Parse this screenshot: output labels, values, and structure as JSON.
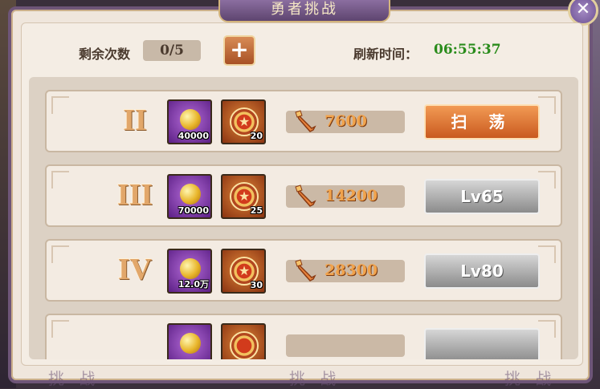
{
  "header": {
    "title": "勇者挑战",
    "close_glyph": "✕"
  },
  "stats": {
    "remaining_label": "剩余次数",
    "remaining_value": "0/5",
    "add_glyph": "+",
    "refresh_label": "刷新时间：",
    "refresh_time": "06:55:37"
  },
  "rows": [
    {
      "tier": "II",
      "orb_qty": "40000",
      "medal_qty": "20",
      "power": "7600",
      "action": "扫 荡",
      "action_state": "sweep"
    },
    {
      "tier": "III",
      "orb_qty": "70000",
      "medal_qty": "25",
      "power": "14200",
      "action": "Lv65",
      "action_state": "locked"
    },
    {
      "tier": "IV",
      "orb_qty": "12.0万",
      "medal_qty": "30",
      "power": "28300",
      "action": "Lv80",
      "action_state": "locked"
    }
  ],
  "footer": {
    "deco_left": "挑 战",
    "deco_mid": "挑 战",
    "deco_right": "挑 战"
  },
  "colors": {
    "accent": "#e06a2a",
    "timer": "#2a8c1c",
    "frame": "#6e5578"
  },
  "icons": {
    "orb": "gold-orb-icon",
    "medal": "star-medal-icon",
    "power": "sword-icon"
  }
}
